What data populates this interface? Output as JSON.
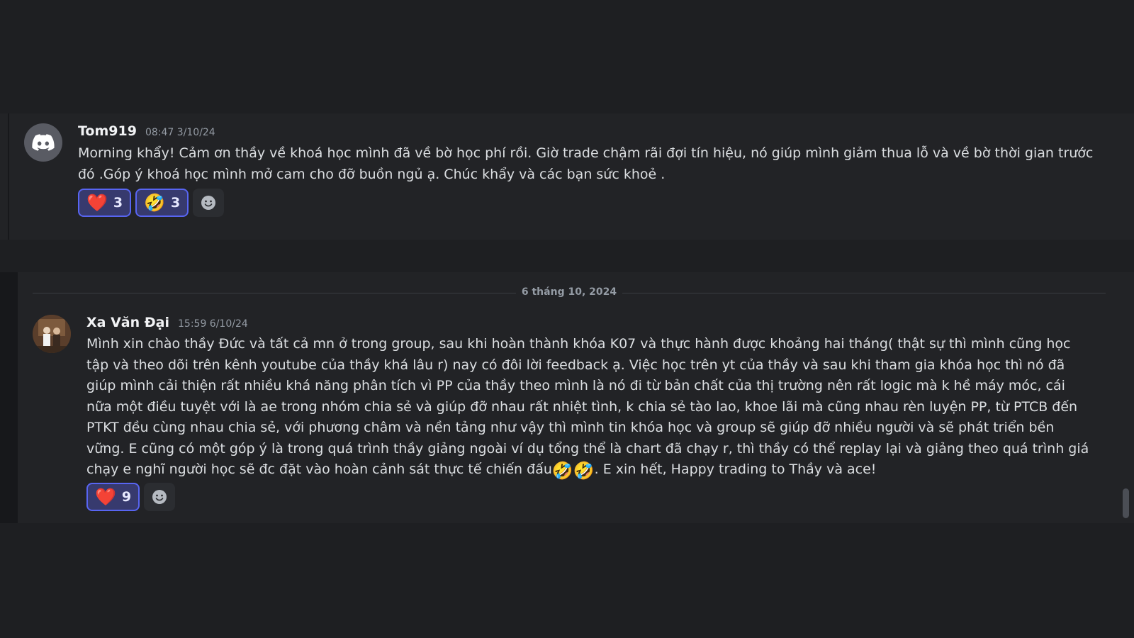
{
  "messages": [
    {
      "username": "Tom919",
      "timestamp": "08:47 3/10/24",
      "avatar_icon": "discord-logo-icon",
      "text": "Morning khẩy! Cảm ơn thầy về khoá học mình đã về bờ học phí rồi. Giờ trade chậm rãi đợi tín hiệu, nó giúp mình giảm thua lỗ và về bờ thời gian trước đó .Góp ý khoá học mình mở cam cho đỡ buồn ngủ ạ. Chúc khẩy và các bạn sức khoẻ .",
      "reactions": [
        {
          "emoji": "❤️",
          "count": "3"
        },
        {
          "emoji": "🤣",
          "count": "3"
        }
      ]
    },
    {
      "username": "Xa Văn Đại",
      "timestamp": "15:59 6/10/24",
      "text_main": "Mình xin chào thầy Đức và tất cả mn ở trong group, sau khi hoàn thành khóa K07 và thực hành được khoảng hai tháng( thật sự thì mình cũng học tập và theo dõi trên kênh youtube của thầy khá lâu r) nay có đôi lời feedback ạ. Việc học trên yt của thầy và sau khi tham gia khóa học thì nó đã giúp mình cải thiện rất nhiều khá năng phân tích vì PP của thầy theo mình là nó đi từ bản chất của thị trường nên rất logic mà k hề máy móc, cái nữa một điều tuyệt với là ae trong nhóm chia sẻ và giúp đỡ nhau rất nhiệt tình, k chia sẻ tào lao, khoe lãi mà cũng nhau rèn luyện PP, từ PTCB đến PTKT đều cùng nhau chia sẻ, với phương châm và nền tảng như vậy thì mình tin khóa học và group sẽ giúp đỡ nhiều người và sẽ phát triển bền vững. E cũng có một góp ý là trong quá trình thầy giảng ngoài ví dụ tổng thể là chart đã chạy r, thì thầy có thể replay lại và giảng theo quá trình giá chạy e nghĩ người học sẽ đc đặt vào hoàn cảnh sát thực tế chiến đấu",
      "emoji_1": "🤣",
      "emoji_2": "🤣",
      "text_end": ". E xin hết, Happy trading to Thầy và ace!",
      "reactions": [
        {
          "emoji": "❤️",
          "count": "9"
        }
      ]
    }
  ],
  "date_divider": "6 tháng 10, 2024",
  "add_reaction_icon": "add-reaction-smiley-icon",
  "colors": {
    "background": "#1e1f22",
    "message_card": "#222326",
    "reaction_border": "#5865f2",
    "reaction_bg": "#373a6e",
    "username": "#f2f3f5",
    "timestamp": "#949ba4"
  }
}
